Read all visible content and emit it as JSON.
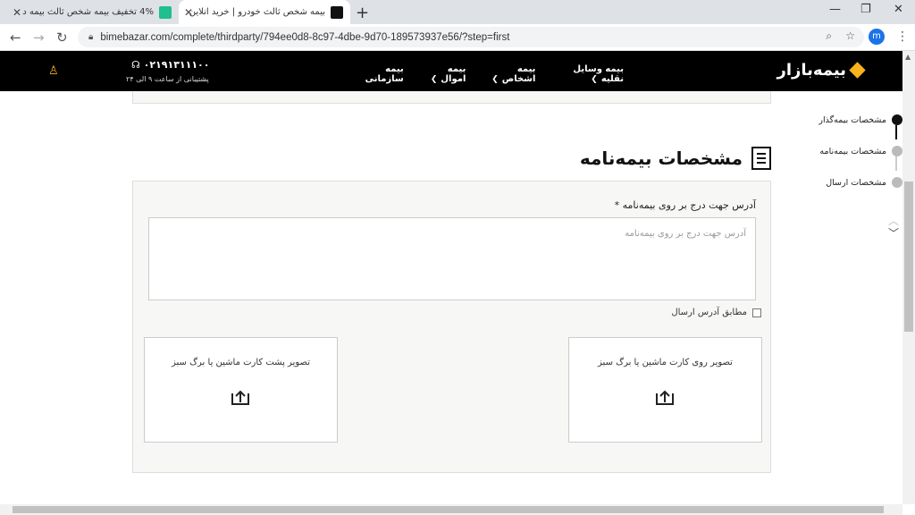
{
  "browser": {
    "tabs": [
      {
        "title": "4% تخفیف بیمه شخص ثالث بیمه د",
        "favicon_color": "#1fbf8f",
        "active": false
      },
      {
        "title": "بیمه شخص ثالث خودرو | خرید آنلاین",
        "favicon_color": "#111111",
        "active": true
      }
    ],
    "new_tab_label": "+",
    "url": "bimebazar.com/complete/thirdparty/794ee0d8-8c97-4dbe-9d70-189573937e56/?step=first",
    "profile_initial": "m"
  },
  "site": {
    "logo_text": "بیمه‌بازار",
    "brand_color": "#f9b21c",
    "nav": [
      {
        "label": "بیمه وسایل نقلیه",
        "has_menu": true
      },
      {
        "label": "بیمه اشخاص",
        "has_menu": true
      },
      {
        "label": "بیمه اموال",
        "has_menu": true
      },
      {
        "label": "بیمه سازمانی",
        "has_menu": false
      }
    ],
    "phone": "۰۲۱۹۱۳۱۱۱۰۰",
    "support_hours": "پشتیبانی از ساعت ۹ الی ۲۴"
  },
  "form": {
    "section_title": "مشخصات بیمه‌نامه",
    "address_label": "آدرس جهت درج بر روی بیمه‌نامه *",
    "address_placeholder": "آدرس جهت درج بر روی بیمه‌نامه",
    "address_value": "",
    "same_as_shipping_label": "مطابق آدرس ارسال",
    "same_as_shipping_checked": false,
    "upload_front_label": "تصویر روی کارت ماشین یا برگ سبز",
    "upload_back_label": "تصویر پشت کارت ماشین یا برگ سبز"
  },
  "stepper": {
    "steps": [
      {
        "label": "مشخصات بیمه‌گذار",
        "active": true
      },
      {
        "label": "مشخصات بیمه‌نامه",
        "active": false
      },
      {
        "label": "مشخصات ارسال",
        "active": false
      }
    ]
  }
}
